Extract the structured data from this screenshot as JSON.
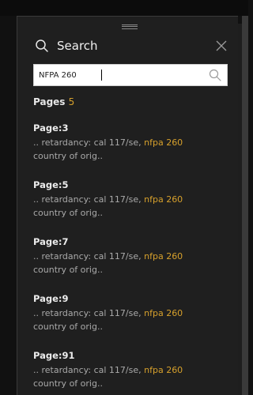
{
  "panel": {
    "title": "Search",
    "search": {
      "value": "NFPA 260"
    },
    "pages_label": "Pages",
    "pages_count": "5",
    "results": [
      {
        "page": "Page:3",
        "snippet_prefix": ".. retardancy: cal 117/se, ",
        "snippet_match": "nfpa 260",
        "snippet_suffix": "country of orig.."
      },
      {
        "page": "Page:5",
        "snippet_prefix": ".. retardancy: cal 117/se, ",
        "snippet_match": "nfpa 260",
        "snippet_suffix": "country of orig.."
      },
      {
        "page": "Page:7",
        "snippet_prefix": ".. retardancy: cal 117/se, ",
        "snippet_match": "nfpa 260",
        "snippet_suffix": "country of orig.."
      },
      {
        "page": "Page:9",
        "snippet_prefix": ".. retardancy: cal 117/se, ",
        "snippet_match": "nfpa 260",
        "snippet_suffix": "country of orig.."
      },
      {
        "page": "Page:91",
        "snippet_prefix": ".. retardancy: cal 117/se, ",
        "snippet_match": "nfpa 260",
        "snippet_suffix": "country of orig.."
      }
    ]
  },
  "icons": {
    "header_search": "search-icon",
    "close": "close-icon",
    "input_search": "search-icon",
    "drag": "drag-handle-icon"
  },
  "colors": {
    "panel_bg": "#1f1f1f",
    "accent": "#d6a02c",
    "text": "#f0f0f0",
    "muted": "#a9a9a9"
  }
}
